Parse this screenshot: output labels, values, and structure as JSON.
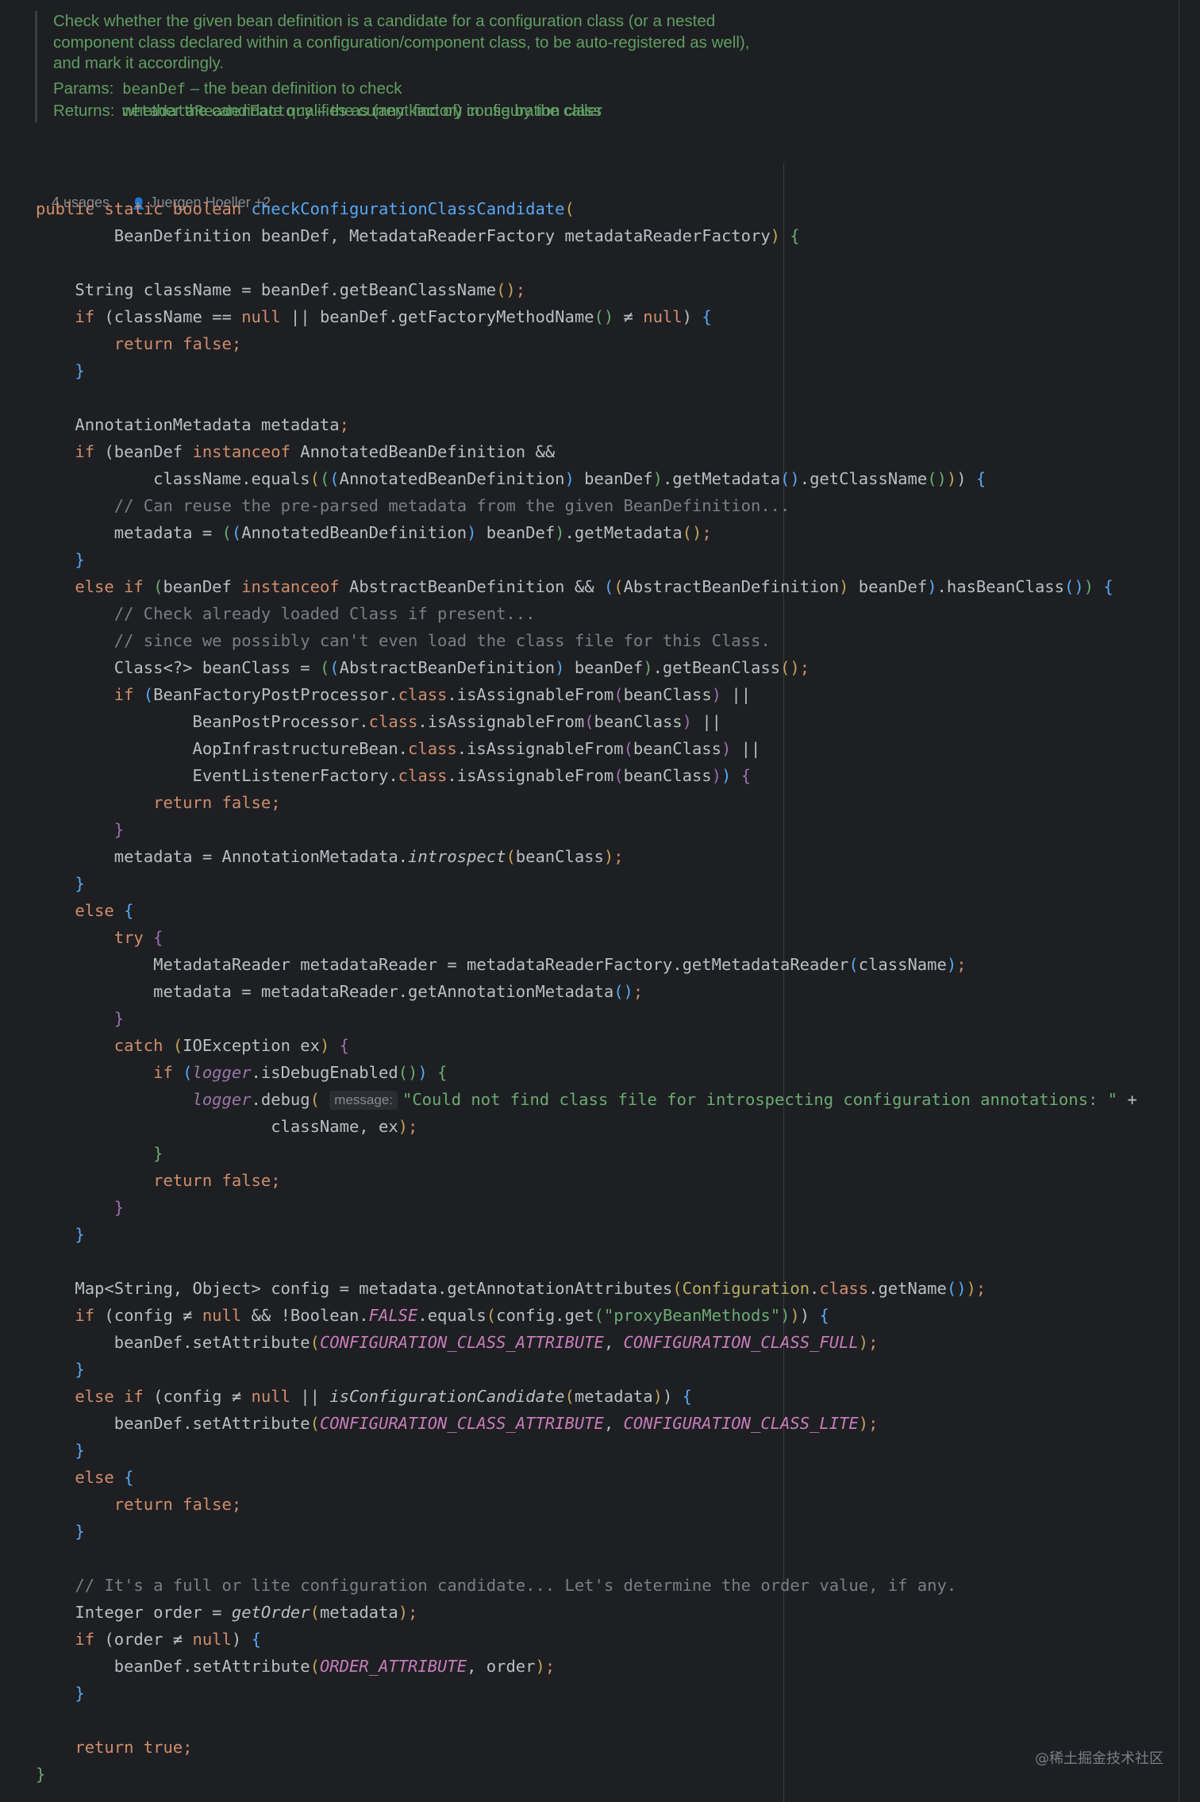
{
  "javadoc": {
    "description_lines": [
      "Check whether the given bean definition is a candidate for a configuration class (or a nested",
      "component class declared within a configuration/component class, to be auto-registered as well),",
      "and mark it accordingly."
    ],
    "params_label": "Params:",
    "params": [
      {
        "name": "beanDef",
        "text": " – the bean definition to check"
      },
      {
        "name": "metadataReaderFactory",
        "text": " – the current factory in use by the caller"
      }
    ],
    "returns_label": "Returns:",
    "returns_text": "whether the candidate qualifies as (any kind of) configuration class"
  },
  "inlay": {
    "usages": "4 usages",
    "authors": "Juergen Hoeller +2",
    "author_icon": "person-icon"
  },
  "code": {
    "hint_message": "message:",
    "lines": {
      "l1_mods": "public static boolean",
      "l1_name": "checkConfigurationClassCandidate",
      "l2_params": "BeanDefinition beanDef, MetadataReaderFactory metadataReaderFactory",
      "l4": "String className = beanDef.getBeanClassName",
      "l5_a": "(className == ",
      "l5_b": " || beanDef.getFactoryMethodName",
      "l5_c": " ≠ ",
      "l8": "AnnotationMetadata metadata",
      "l9_a": "(beanDef ",
      "l9_b": " AnnotatedBeanDefinition &&",
      "l10": "className.equals",
      "l10_b": "AnnotatedBeanDefinition",
      "l10_c": " beanDef",
      "l10_d": ".getMetadata",
      "l10_e": ".getClassName",
      "l11": "// Can reuse the pre-parsed metadata from the given BeanDefinition...",
      "l12_a": "metadata = ",
      "l12_b": "AnnotatedBeanDefinition",
      "l12_c": " beanDef",
      "l12_d": ".getMetadata",
      "l14_a": " AbstractBeanDefinition && ",
      "l14_b": "AbstractBeanDefinition",
      "l14_c": " beanDef",
      "l14_d": ".hasBeanClass",
      "l15": "// Check already loaded Class if present...",
      "l16": "// since we possibly can't even load the class file for this Class.",
      "l17_a": "Class<?> beanClass = ",
      "l17_b": "AbstractBeanDefinition",
      "l17_c": " beanDef",
      "l17_d": ".getBeanClass",
      "l18": "BeanFactoryPostProcessor.",
      "l19": "BeanPostProcessor.",
      "l20": "AopInfrastructureBean.",
      "l21": "EventListenerFactory.",
      "isAssignable": ".isAssignableFrom",
      "beanClass": "beanClass",
      "l24_a": "metadata = AnnotationMetadata.",
      "l24_b": "introspect",
      "l28_a": "MetadataReader metadataReader = metadataReaderFactory.getMetadataReader",
      "l28_b": "className",
      "l29": "metadata = metadataReader.getAnnotationMetadata",
      "l31": "IOException ex",
      "logger": "logger",
      "l32_b": ".isDebugEnabled",
      "l33_b": ".debug",
      "l33_str": "\"Could not find class file for introspecting configuration annotations: \"",
      "l34": "className, ex",
      "l40_a": "Map<String, Object> config = metadata.getAnnotationAttributes",
      "l40_ann": "Configuration",
      "l40_b": ".getName",
      "l41_a": "(config ≠ ",
      "l41_b": " && !Boolean.",
      "l41_false": "FALSE",
      "l41_c": ".equals",
      "l41_d": "config.get",
      "l41_str": "\"proxyBeanMethods\"",
      "l42_a": "beanDef.setAttribute",
      "attr_cc": "CONFIGURATION_CLASS_ATTRIBUTE",
      "full": "CONFIGURATION_CLASS_FULL",
      "lite": "CONFIGURATION_CLASS_LITE",
      "l44_a": "(config ≠ ",
      "l44_b": " || ",
      "l44_fn": "isConfigurationCandidate",
      "metadata": "metadata",
      "l51": "// It's a full or lite configuration candidate... Let's determine the order value, if any.",
      "l52_a": "Integer order = ",
      "l52_fn": "getOrder",
      "l53": "(order ≠ ",
      "order_attr": "ORDER_ATTRIBUTE",
      "order": "order",
      "kw_if": "if",
      "kw_else": "else",
      "kw_elseif": "else if",
      "kw_try": "try",
      "kw_catch": "catch",
      "kw_return": "return",
      "kw_false": "false;",
      "kw_true": "true",
      "kw_null": "null",
      "kw_instanceof": "instanceof",
      "kw_class": "class"
    }
  },
  "watermark": "@稀土掘金技术社区"
}
